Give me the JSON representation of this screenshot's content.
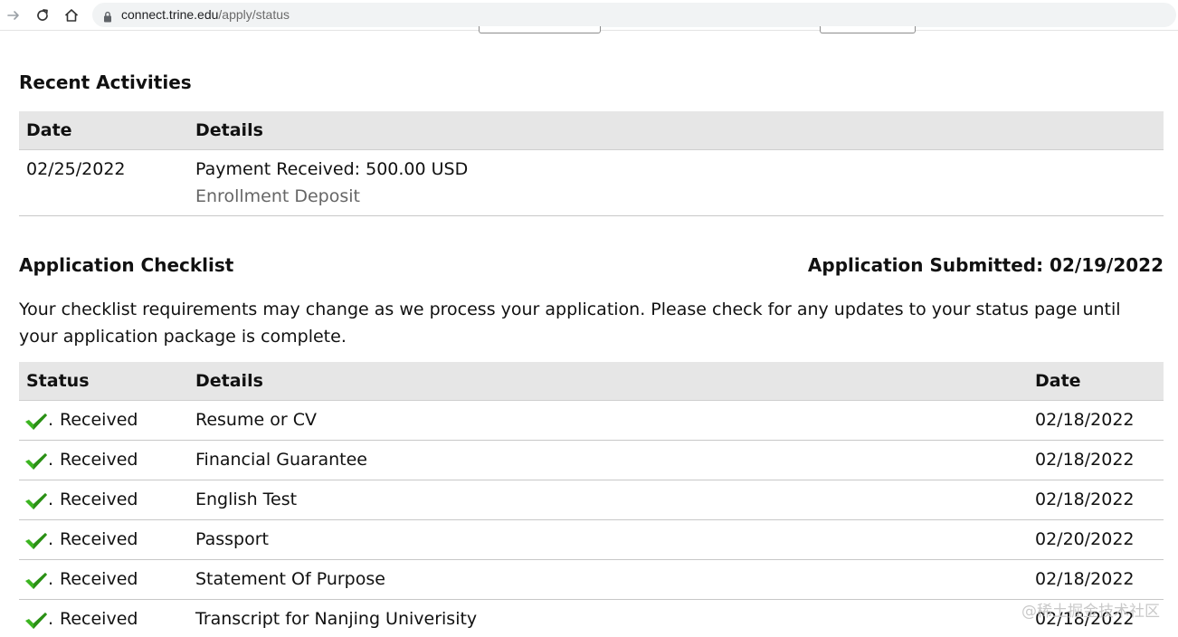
{
  "browser": {
    "url_domain": "connect.trine.edu",
    "url_path": "/apply/status",
    "icons": [
      "forward-arrow-icon",
      "reload-icon",
      "home-icon",
      "lock-icon"
    ]
  },
  "recent": {
    "title": "Recent Activities",
    "columns": [
      "Date",
      "Details"
    ],
    "rows": [
      {
        "date": "02/25/2022",
        "detail": "Payment Received: 500.00 USD",
        "subdetail": "Enrollment Deposit"
      }
    ]
  },
  "checklist": {
    "title": "Application Checklist",
    "submitted": "Application Submitted: 02/19/2022",
    "note": "Your checklist requirements may change as we process your application. Please check for any updates to your status page until your application package is complete.",
    "columns": [
      "Status",
      "Details",
      "Date"
    ],
    "rows": [
      {
        "status": "Received",
        "detail": "Resume or CV",
        "date": "02/18/2022"
      },
      {
        "status": "Received",
        "detail": "Financial Guarantee",
        "date": "02/18/2022"
      },
      {
        "status": "Received",
        "detail": "English Test",
        "date": "02/18/2022"
      },
      {
        "status": "Received",
        "detail": "Passport",
        "date": "02/20/2022"
      },
      {
        "status": "Received",
        "detail": "Statement Of Purpose",
        "date": "02/18/2022"
      },
      {
        "status": "Received",
        "detail": "Transcript for Nanjing Univerisity",
        "date": "02/18/2022"
      }
    ],
    "check_icon": "green-check-icon",
    "dot": "."
  },
  "watermark": "@稀土掘金技术社区",
  "colors": {
    "header_bg": "#e6e6e6",
    "check_green": "#3cb521",
    "muted_text": "#666666"
  }
}
